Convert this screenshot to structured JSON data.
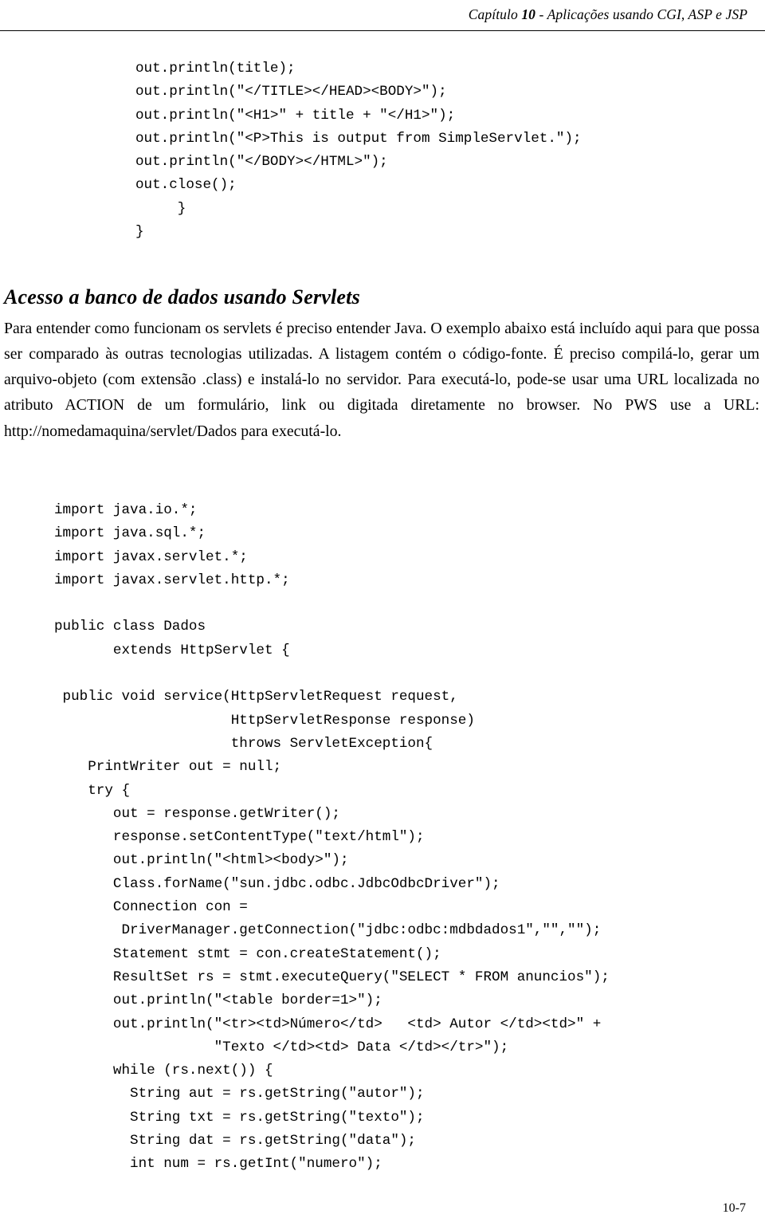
{
  "header": {
    "chapter_number": "10",
    "prefix": "Capítulo ",
    "title_rest": " - Aplicações usando CGI, ASP e JSP"
  },
  "code_block_1": "out.println(title);\nout.println(\"</TITLE></HEAD><BODY>\");\nout.println(\"<H1>\" + title + \"</H1>\");\nout.println(\"<P>This is output from SimpleServlet.\");\nout.println(\"</BODY></HTML>\");\nout.close();\n     }\n}",
  "section": {
    "heading": "Acesso a banco de dados usando Servlets",
    "paragraph": "Para entender como funcionam os servlets é preciso entender Java. O exemplo abaixo está incluído aqui para que possa ser comparado às outras tecnologias utilizadas. A listagem contém o código-fonte. É preciso compilá-lo, gerar um arquivo-objeto (com extensão .class) e instalá-lo no servidor. Para executá-lo, pode-se usar uma URL localizada no atributo ACTION de um formulário, link ou digitada diretamente no browser. No PWS use a URL: http://nomedamaquina/servlet/Dados para executá-lo."
  },
  "code_block_2": "import java.io.*;\nimport java.sql.*;\nimport javax.servlet.*;\nimport javax.servlet.http.*;\n\npublic class Dados\n       extends HttpServlet {\n\n public void service(HttpServletRequest request,\n                     HttpServletResponse response)\n                     throws ServletException{\n    PrintWriter out = null;\n    try {\n       out = response.getWriter();\n       response.setContentType(\"text/html\");\n       out.println(\"<html><body>\");\n       Class.forName(\"sun.jdbc.odbc.JdbcOdbcDriver\");\n       Connection con =\n        DriverManager.getConnection(\"jdbc:odbc:mdbdados1\",\"\",\"\");\n       Statement stmt = con.createStatement();\n       ResultSet rs = stmt.executeQuery(\"SELECT * FROM anuncios\");\n       out.println(\"<table border=1>\");\n       out.println(\"<tr><td>Número</td>   <td> Autor </td><td>\" +\n                   \"Texto </td><td> Data </td></tr>\");\n       while (rs.next()) {\n         String aut = rs.getString(\"autor\");\n         String txt = rs.getString(\"texto\");\n         String dat = rs.getString(\"data\");\n         int num = rs.getInt(\"numero\");",
  "footer": {
    "page_number": "10-7"
  }
}
